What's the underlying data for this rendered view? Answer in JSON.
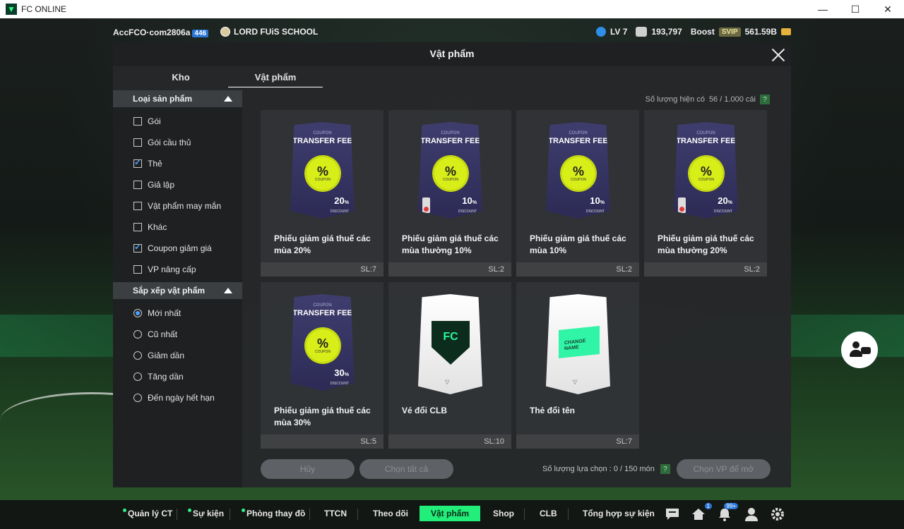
{
  "window": {
    "title": "FC ONLINE",
    "controls": {
      "minimize": "—",
      "maximize": "☐",
      "close": "✕"
    }
  },
  "topbar": {
    "account_name": "AccFCO·com2806a",
    "account_badge": "446",
    "club_name": "LORD FUiS SCHOOL",
    "level": "LV 7",
    "coins": "193,797",
    "boost_label": "Boost",
    "svip_label": "SVIP",
    "bp": "561.59B"
  },
  "panel": {
    "title": "Vật phẩm",
    "tabs": [
      {
        "label": "Kho",
        "active": false
      },
      {
        "label": "Vật phẩm",
        "active": true
      }
    ],
    "count_label": "Số lượng hiện có",
    "count_value": "56 / 1.000 cái",
    "help_label": "?"
  },
  "filters": {
    "product_type": {
      "title": "Loại sản phẩm",
      "options": [
        {
          "label": "Gói",
          "checked": false
        },
        {
          "label": "Gói cầu thủ",
          "checked": false
        },
        {
          "label": "Thẻ",
          "checked": true
        },
        {
          "label": "Giả lập",
          "checked": false
        },
        {
          "label": "Vật phẩm may mắn",
          "checked": false
        },
        {
          "label": "Khác",
          "checked": false
        },
        {
          "label": "Coupon giảm giá",
          "checked": true
        },
        {
          "label": "VP nâng cấp",
          "checked": false
        }
      ]
    },
    "sort": {
      "title": "Sắp xếp vật phẩm",
      "options": [
        {
          "label": "Mới nhất",
          "checked": true
        },
        {
          "label": "Cũ nhất",
          "checked": false
        },
        {
          "label": "Giảm dần",
          "checked": false
        },
        {
          "label": "Tăng dần",
          "checked": false
        },
        {
          "label": "Đến ngày hết hạn",
          "checked": false
        }
      ]
    }
  },
  "items": [
    {
      "name": "Phiếu giảm giá thuế các mùa 20%",
      "qty": "SL:7",
      "type": "coupon",
      "coupon_label": "COUPON",
      "header": "TRANSFER FEE",
      "discount": "20",
      "discount_unit": "%",
      "discount_label": "DISCOUNT",
      "tag": false
    },
    {
      "name": "Phiếu giảm giá thuế các mùa thường 10%",
      "qty": "SL:2",
      "type": "coupon",
      "coupon_label": "COUPON",
      "header": "TRANSFER FEE",
      "discount": "10",
      "discount_unit": "%",
      "discount_label": "DISCOUNT",
      "tag": true
    },
    {
      "name": "Phiếu giảm giá thuế các mùa 10%",
      "qty": "SL:2",
      "type": "coupon",
      "coupon_label": "COUPON",
      "header": "TRANSFER FEE",
      "discount": "10",
      "discount_unit": "%",
      "discount_label": "DISCOUNT",
      "tag": false
    },
    {
      "name": "Phiếu giảm giá thuế các mùa thường 20%",
      "qty": "SL:2",
      "type": "coupon",
      "coupon_label": "COUPON",
      "header": "TRANSFER FEE",
      "discount": "20",
      "discount_unit": "%",
      "discount_label": "DISCOUNT",
      "tag": true
    },
    {
      "name": "Phiếu giảm giá thuế các mùa 30%",
      "qty": "SL:5",
      "type": "coupon",
      "coupon_label": "COUPON",
      "header": "TRANSFER FEE",
      "discount": "30",
      "discount_unit": "%",
      "discount_label": "DISCOUNT",
      "tag": false
    },
    {
      "name": "Vé đổi CLB",
      "qty": "SL:10",
      "type": "club",
      "emblem": "FC"
    },
    {
      "name": "Thẻ đổi tên",
      "qty": "SL:7",
      "type": "rename",
      "tag_text": "CHANGE NAME"
    }
  ],
  "actions": {
    "cancel": "Hủy",
    "select_all": "Chọn tất cả",
    "selection_label": "Số lượng lựa chọn : 0 / 150 món",
    "sell": "Chọn VP để mở"
  },
  "nav": {
    "items": [
      {
        "label": "Quản lý CT",
        "dot": true,
        "active": false
      },
      {
        "label": "Sự kiện",
        "dot": true,
        "active": false
      },
      {
        "label": "Phòng thay đồ",
        "dot": true,
        "active": false
      },
      {
        "label": "TTCN",
        "dot": false,
        "active": false
      },
      {
        "label": "Theo dõi",
        "dot": false,
        "active": false
      },
      {
        "label": "Vật phẩm",
        "dot": false,
        "active": true
      },
      {
        "label": "Shop",
        "dot": false,
        "active": false
      },
      {
        "label": "CLB",
        "dot": false,
        "active": false
      },
      {
        "label": "Tổng hợp sự kiện",
        "dot": false,
        "active": false
      }
    ],
    "icons": [
      {
        "name": "chat-icon",
        "badge": ""
      },
      {
        "name": "home-icon",
        "badge": "1"
      },
      {
        "name": "bell-icon",
        "badge": "99+"
      },
      {
        "name": "profile-icon",
        "badge": ""
      },
      {
        "name": "gear-icon",
        "badge": ""
      }
    ]
  }
}
